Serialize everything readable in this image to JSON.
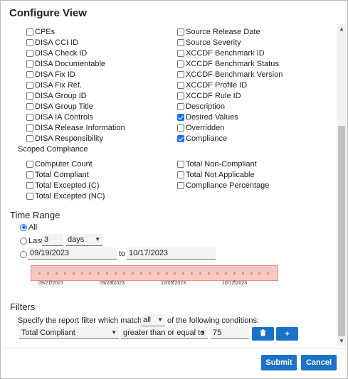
{
  "dialog": {
    "title": "Configure View"
  },
  "columns": {
    "left": [
      {
        "label": "CPEs",
        "checked": false
      },
      {
        "label": "DISA CCI ID",
        "checked": false
      },
      {
        "label": "DISA Check ID",
        "checked": false
      },
      {
        "label": "DISA Documentable",
        "checked": false
      },
      {
        "label": "DISA Fix ID",
        "checked": false
      },
      {
        "label": "DISA Fix Ref.",
        "checked": false
      },
      {
        "label": "DISA Group ID",
        "checked": false
      },
      {
        "label": "DISA Group Title",
        "checked": false
      },
      {
        "label": "DISA IA Controls",
        "checked": false
      },
      {
        "label": "DISA Release Information",
        "checked": false
      },
      {
        "label": "DISA Responsibility",
        "checked": false
      }
    ],
    "right": [
      {
        "label": "Source Release Date",
        "checked": false
      },
      {
        "label": "Source Severity",
        "checked": false
      },
      {
        "label": "XCCDF Benchmark ID",
        "checked": false
      },
      {
        "label": "XCCDF Benchmark Status",
        "checked": false
      },
      {
        "label": "XCCDF Benchmark Version",
        "checked": false
      },
      {
        "label": "XCCDF Profile ID",
        "checked": false
      },
      {
        "label": "XCCDF Rule ID",
        "checked": false
      },
      {
        "label": "Description",
        "checked": false
      },
      {
        "label": "Desired Values",
        "checked": true
      },
      {
        "label": "Overridden",
        "checked": false
      },
      {
        "label": "Compliance",
        "checked": true
      }
    ]
  },
  "scoped": {
    "label": "Scoped Compliance",
    "left": [
      {
        "label": "Computer Count",
        "checked": false
      },
      {
        "label": "Total Compliant",
        "checked": false
      },
      {
        "label": "Total Excepted (C)",
        "checked": false
      },
      {
        "label": "Total Excepted (NC)",
        "checked": false
      }
    ],
    "right": [
      {
        "label": "Total Non-Compliant",
        "checked": false
      },
      {
        "label": "Total Not Applicable",
        "checked": false
      },
      {
        "label": "Compliance Percentage",
        "checked": false
      }
    ]
  },
  "time_range": {
    "heading": "Time Range",
    "all_label": "All",
    "last_label": "Last",
    "last_value": "3",
    "last_unit": "days",
    "from_date": "09/19/2023",
    "to_label": "to",
    "to_date": "10/17/2023",
    "timeline_ticks": [
      "09/21/2023",
      "09/28/2023",
      "10/05/2023",
      "10/12/2023"
    ],
    "selected": "all"
  },
  "filters": {
    "heading": "Filters",
    "specify_prefix": "Specify the report filter which matches",
    "match_value": "all",
    "specify_suffix": "of the following conditions:",
    "field": "Total Compliant",
    "operator": "greater than or equal to",
    "value": "75",
    "delete_icon": "trash-icon",
    "add_label": "+"
  },
  "footer": {
    "submit_label": "Submit",
    "cancel_label": "Cancel"
  },
  "colors": {
    "accent": "#1a73c8",
    "timeline_fill": "#f8c9c3",
    "timeline_border": "#f08a7d",
    "timeline_dot": "#e8855b"
  }
}
